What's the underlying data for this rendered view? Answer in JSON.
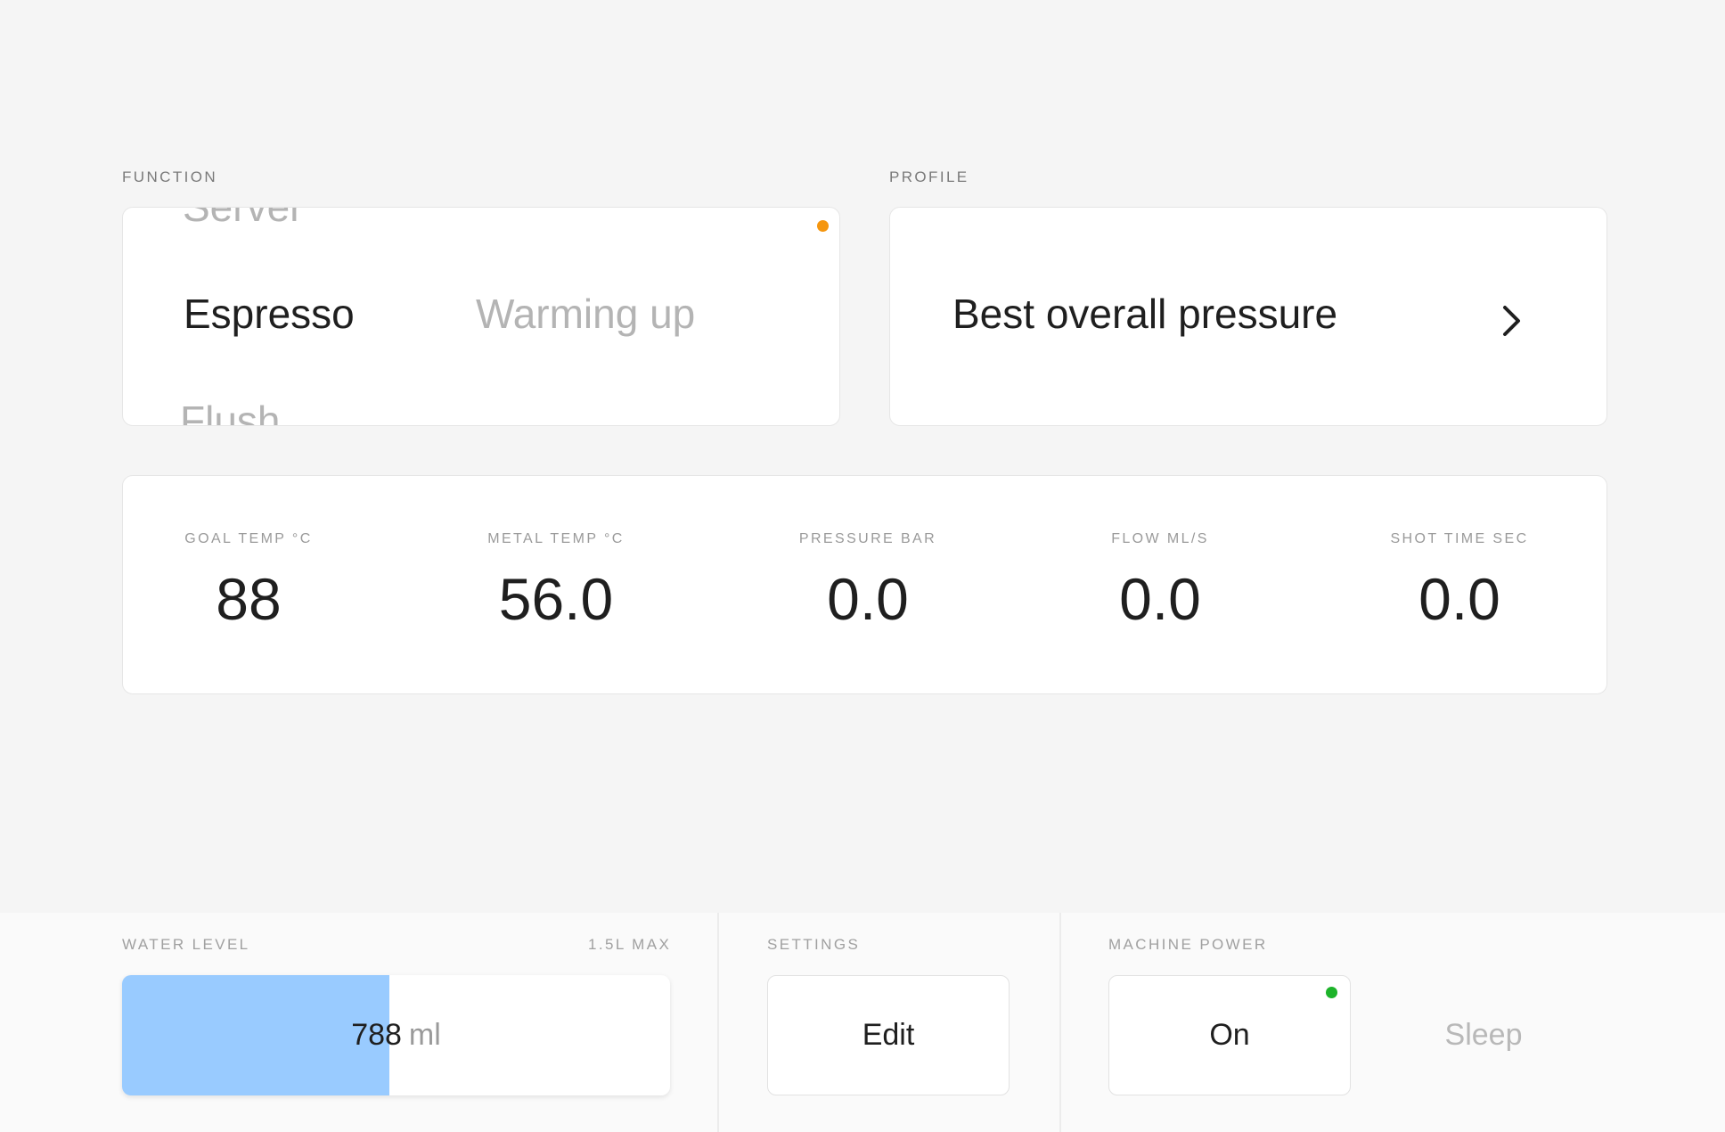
{
  "function": {
    "label": "FUNCTION",
    "options": [
      "Server",
      "Espresso",
      "Flush"
    ],
    "selected": "Espresso",
    "status": "Warming up",
    "status_color": "#f5960f"
  },
  "profile": {
    "label": "PROFILE",
    "name": "Best overall pressure",
    "chevron_icon": "chevron-right-icon"
  },
  "metrics": [
    {
      "label": "GOAL TEMP °C",
      "value": "88"
    },
    {
      "label": "METAL TEMP °C",
      "value": "56.0"
    },
    {
      "label": "PRESSURE BAR",
      "value": "0.0"
    },
    {
      "label": "FLOW ML/S",
      "value": "0.0"
    },
    {
      "label": "SHOT TIME SEC",
      "value": "0.0"
    }
  ],
  "water": {
    "label": "WATER LEVEL",
    "max_label": "1.5L MAX",
    "value": "788",
    "unit": "ml",
    "fill_fraction": 0.4875,
    "fill_color": "#99cbff"
  },
  "settings": {
    "label": "SETTINGS",
    "button": "Edit"
  },
  "power": {
    "label": "MACHINE POWER",
    "on_label": "On",
    "sleep_label": "Sleep",
    "on_dot_color": "#1db32a"
  }
}
